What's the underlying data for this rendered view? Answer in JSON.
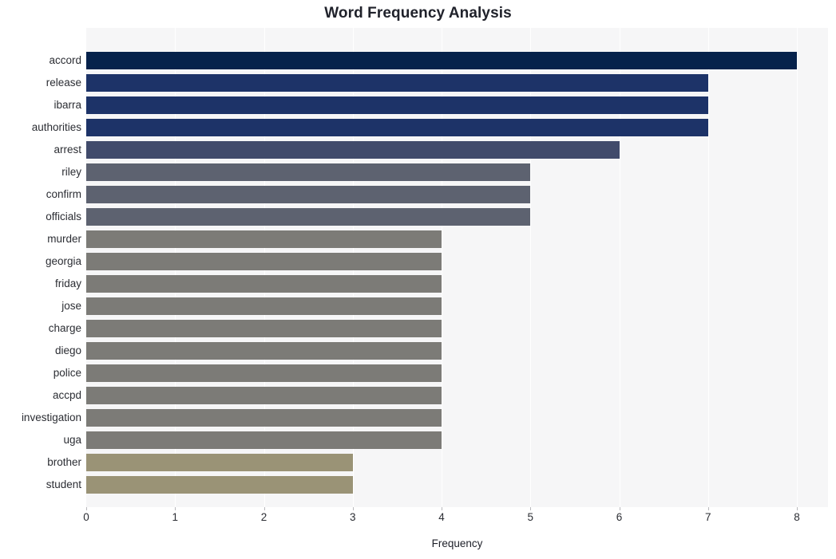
{
  "chart_data": {
    "type": "bar",
    "orientation": "horizontal",
    "title": "Word Frequency Analysis",
    "xlabel": "Frequency",
    "ylabel": "",
    "xlim": [
      0,
      8.35
    ],
    "xticks": [
      0,
      1,
      2,
      3,
      4,
      5,
      6,
      7,
      8
    ],
    "xtick_labels": [
      "0",
      "1",
      "2",
      "3",
      "4",
      "5",
      "6",
      "7",
      "8"
    ],
    "grid": "vertical-white-on-gray",
    "legend": null,
    "categories": [
      "accord",
      "release",
      "ibarra",
      "authorities",
      "arrest",
      "riley",
      "confirm",
      "officials",
      "murder",
      "georgia",
      "friday",
      "jose",
      "charge",
      "diego",
      "police",
      "accpd",
      "investigation",
      "uga",
      "brother",
      "student"
    ],
    "values": [
      8,
      7,
      7,
      7,
      6,
      5,
      5,
      5,
      4,
      4,
      4,
      4,
      4,
      4,
      4,
      4,
      4,
      4,
      3,
      3
    ],
    "bar_colors": [
      "#06224b",
      "#1d3368",
      "#1d3368",
      "#1d3368",
      "#414b6b",
      "#5d6270",
      "#5d6270",
      "#5d6270",
      "#7c7b77",
      "#7c7b77",
      "#7c7b77",
      "#7c7b77",
      "#7c7b77",
      "#7c7b77",
      "#7c7b77",
      "#7c7b77",
      "#7c7b77",
      "#7c7b77",
      "#9a9376",
      "#9a9376"
    ],
    "plot_background": "#f6f6f7",
    "figure_background": "#ffffff",
    "gridline_color": "#ffffff"
  }
}
